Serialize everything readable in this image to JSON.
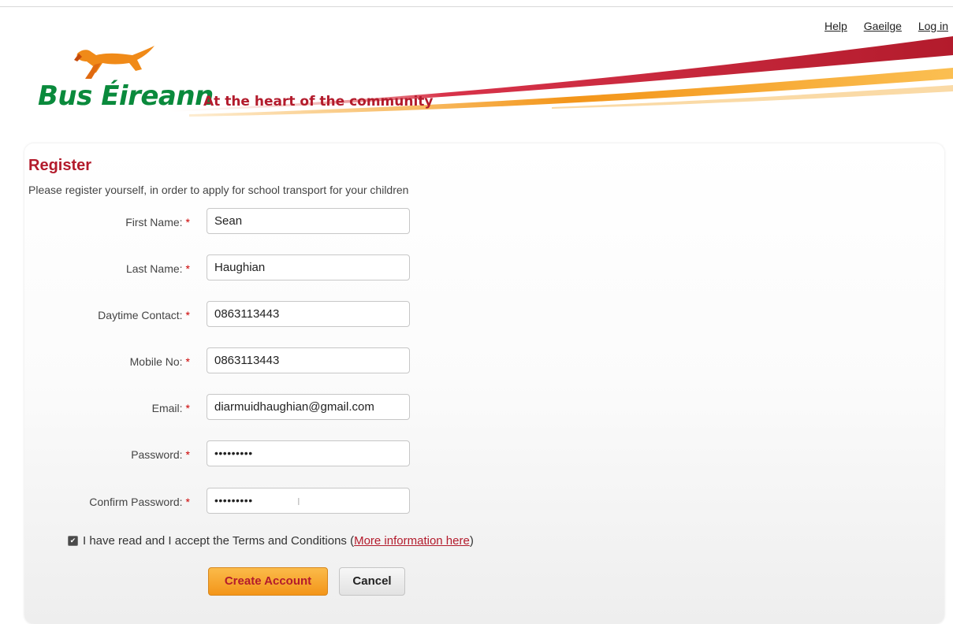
{
  "header": {
    "links": {
      "help": "Help",
      "language": "Gaeilge",
      "login": "Log in"
    },
    "brand": "Bus Éireann",
    "tagline": "At the heart of the community",
    "logo_icon": "setter-dog-logo-icon"
  },
  "form": {
    "title": "Register",
    "subtitle": "Please register yourself, in order to apply for school transport for your children",
    "required_marker": "*",
    "fields": {
      "first_name": {
        "label": "First Name:",
        "value": "Sean"
      },
      "last_name": {
        "label": "Last Name:",
        "value": "Haughian"
      },
      "daytime_contact": {
        "label": "Daytime Contact:",
        "value": "0863113443"
      },
      "mobile_no": {
        "label": "Mobile No:",
        "value": "0863113443"
      },
      "email": {
        "label": "Email:",
        "value": "diarmuidhaughian@gmail.com"
      },
      "password": {
        "label": "Password:",
        "value": "•••••••••"
      },
      "confirm_password": {
        "label": "Confirm Password:",
        "value": "•••••••••"
      }
    },
    "terms": {
      "checked": true,
      "text": "I have read and I accept the Terms and Conditions (",
      "link": "More information here",
      "close": ")"
    },
    "buttons": {
      "create": "Create Account",
      "cancel": "Cancel"
    }
  },
  "colors": {
    "brand_green": "#0a8a3c",
    "brand_red": "#b31b2c",
    "accent_orange": "#f39519"
  }
}
